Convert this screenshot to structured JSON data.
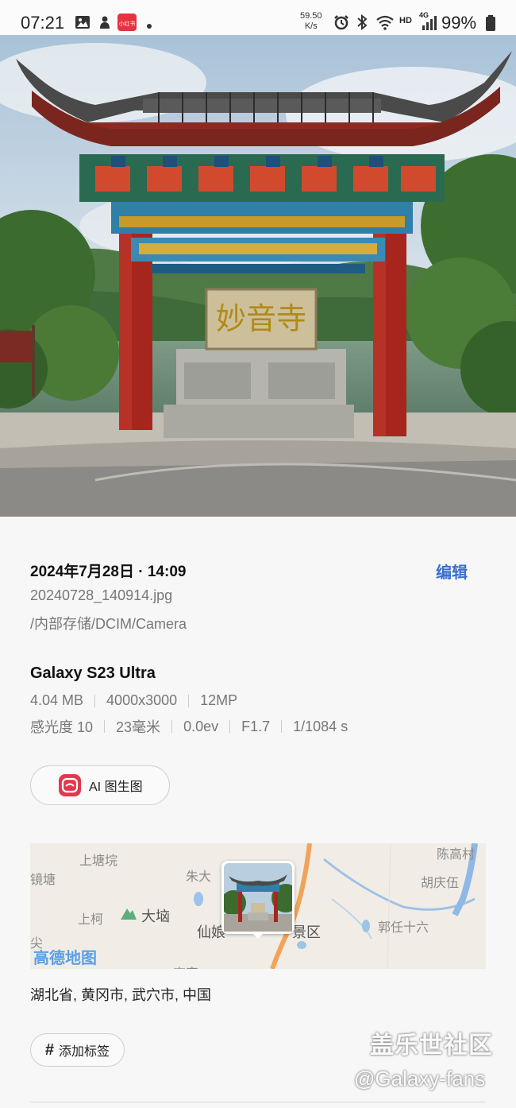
{
  "status_bar": {
    "time": "07:21",
    "net_speed_value": "59.50",
    "net_speed_unit": "K/s",
    "network_hd": "HD",
    "network_gen": "4G",
    "battery": "99%"
  },
  "details": {
    "date_time": "2024年7月28日 · 14:09",
    "edit_label": "编辑",
    "file_name": "20240728_140914.jpg",
    "file_path": "/内部存储/DCIM/Camera",
    "device": "Galaxy S23 Ultra",
    "specs_row1": [
      "4.04 MB",
      "4000x3000",
      "12MP"
    ],
    "specs_row2": [
      "感光度 10",
      "23毫米",
      "0.0ev",
      "F1.7",
      "1/1084 s"
    ]
  },
  "ai_button": {
    "label": "AI 图生图"
  },
  "photo": {
    "sign_text": "妙音寺"
  },
  "map": {
    "labels": {
      "shangtangkeng": "上塘垸",
      "jingtang": "镜塘",
      "zhuda": "朱大",
      "chengaocun": "陈高村",
      "huqingwu": "胡庆伍",
      "shangke": "上柯",
      "dakang": "大垴",
      "xian": "仙娘",
      "quarea": "景区",
      "guorenshiliu": "郭任十六",
      "jian": "尖",
      "bottom": "李家"
    },
    "brand": "高德地图"
  },
  "address": "湖北省, 黄冈市, 武穴市, 中国",
  "tag_button": {
    "hash": "#",
    "label": "添加标签"
  },
  "watermark": {
    "line1": "盖乐世社区",
    "line2": "@Galaxy-fans"
  }
}
